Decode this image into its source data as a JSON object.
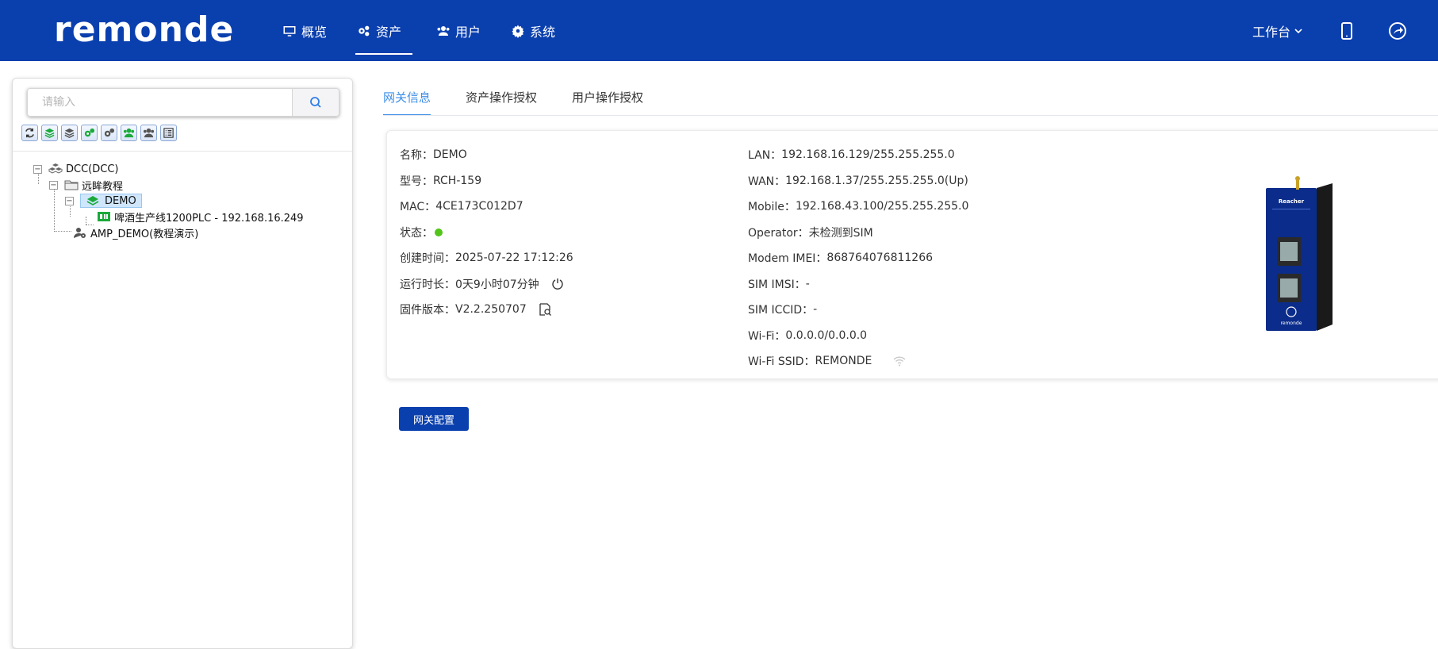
{
  "brand": {
    "logo_text": "remonde"
  },
  "nav": {
    "items": [
      {
        "label": "概览",
        "icon": "monitor-icon"
      },
      {
        "label": "资产",
        "icon": "gears-icon"
      },
      {
        "label": "用户",
        "icon": "users-icon"
      },
      {
        "label": "系统",
        "icon": "gear-icon"
      }
    ],
    "active_index": 1
  },
  "topbar": {
    "workbench_label": "工作台",
    "icons": [
      "mobile-icon",
      "share-icon"
    ]
  },
  "sidebar": {
    "search_placeholder": "请输入",
    "toolbar_icons": [
      "refresh-icon",
      "layer-green-icon",
      "layer-gray-icon",
      "gears-green-icon",
      "gears-icon",
      "users-green-icon",
      "users-icon",
      "list-icon"
    ],
    "tree": [
      {
        "label": "DCC(DCC)",
        "level": 0,
        "icon": "cluster-icon"
      },
      {
        "label": "远眸教程",
        "level": 1,
        "icon": "folder-icon"
      },
      {
        "label": "DEMO",
        "level": 2,
        "icon": "gateway-icon",
        "selected": true
      },
      {
        "label": "啤酒生产线1200PLC - 192.168.16.249",
        "level": 3,
        "icon": "plc-icon"
      },
      {
        "label": "AMP_DEMO(教程演示)",
        "level": 1,
        "icon": "user-gear-icon"
      }
    ]
  },
  "tabs": [
    "网关信息",
    "资产操作授权",
    "用户操作授权"
  ],
  "gateway": {
    "left": [
      {
        "key": "名称：",
        "value": "DEMO"
      },
      {
        "key": "型号：",
        "value": "RCH-159"
      },
      {
        "key": "MAC：",
        "value": "4CE173C012D7"
      },
      {
        "key": "状态：",
        "value": ""
      },
      {
        "key": "创建时间：",
        "value": "2025-07-22 17:12:26"
      },
      {
        "key": "运行时长：",
        "value": "0天9小时07分钟"
      },
      {
        "key": "固件版本：",
        "value": "V2.2.250707"
      }
    ],
    "right": [
      {
        "key": "LAN：",
        "value": "192.168.16.129/255.255.255.0"
      },
      {
        "key": "WAN：",
        "value": "192.168.1.37/255.255.255.0(Up)"
      },
      {
        "key": "Mobile：",
        "value": "192.168.43.100/255.255.255.0"
      },
      {
        "key": "Operator：",
        "value": "未检测到SIM"
      },
      {
        "key": "Modem IMEI：",
        "value": "868764076811266"
      },
      {
        "key": "SIM IMSI：",
        "value": "-"
      },
      {
        "key": "SIM ICCID：",
        "value": "-"
      },
      {
        "key": "Wi-Fi：",
        "value": "0.0.0.0/0.0.0.0"
      },
      {
        "key": "Wi-Fi SSID：",
        "value": "REMONDE"
      }
    ],
    "status_color": "#52c41a",
    "device_label": "Reacher",
    "device_brand": "remonde"
  },
  "actions": {
    "config_button": "网关配置"
  },
  "colors": {
    "primary": "#0a3fae",
    "accent": "#3d8ee8"
  }
}
